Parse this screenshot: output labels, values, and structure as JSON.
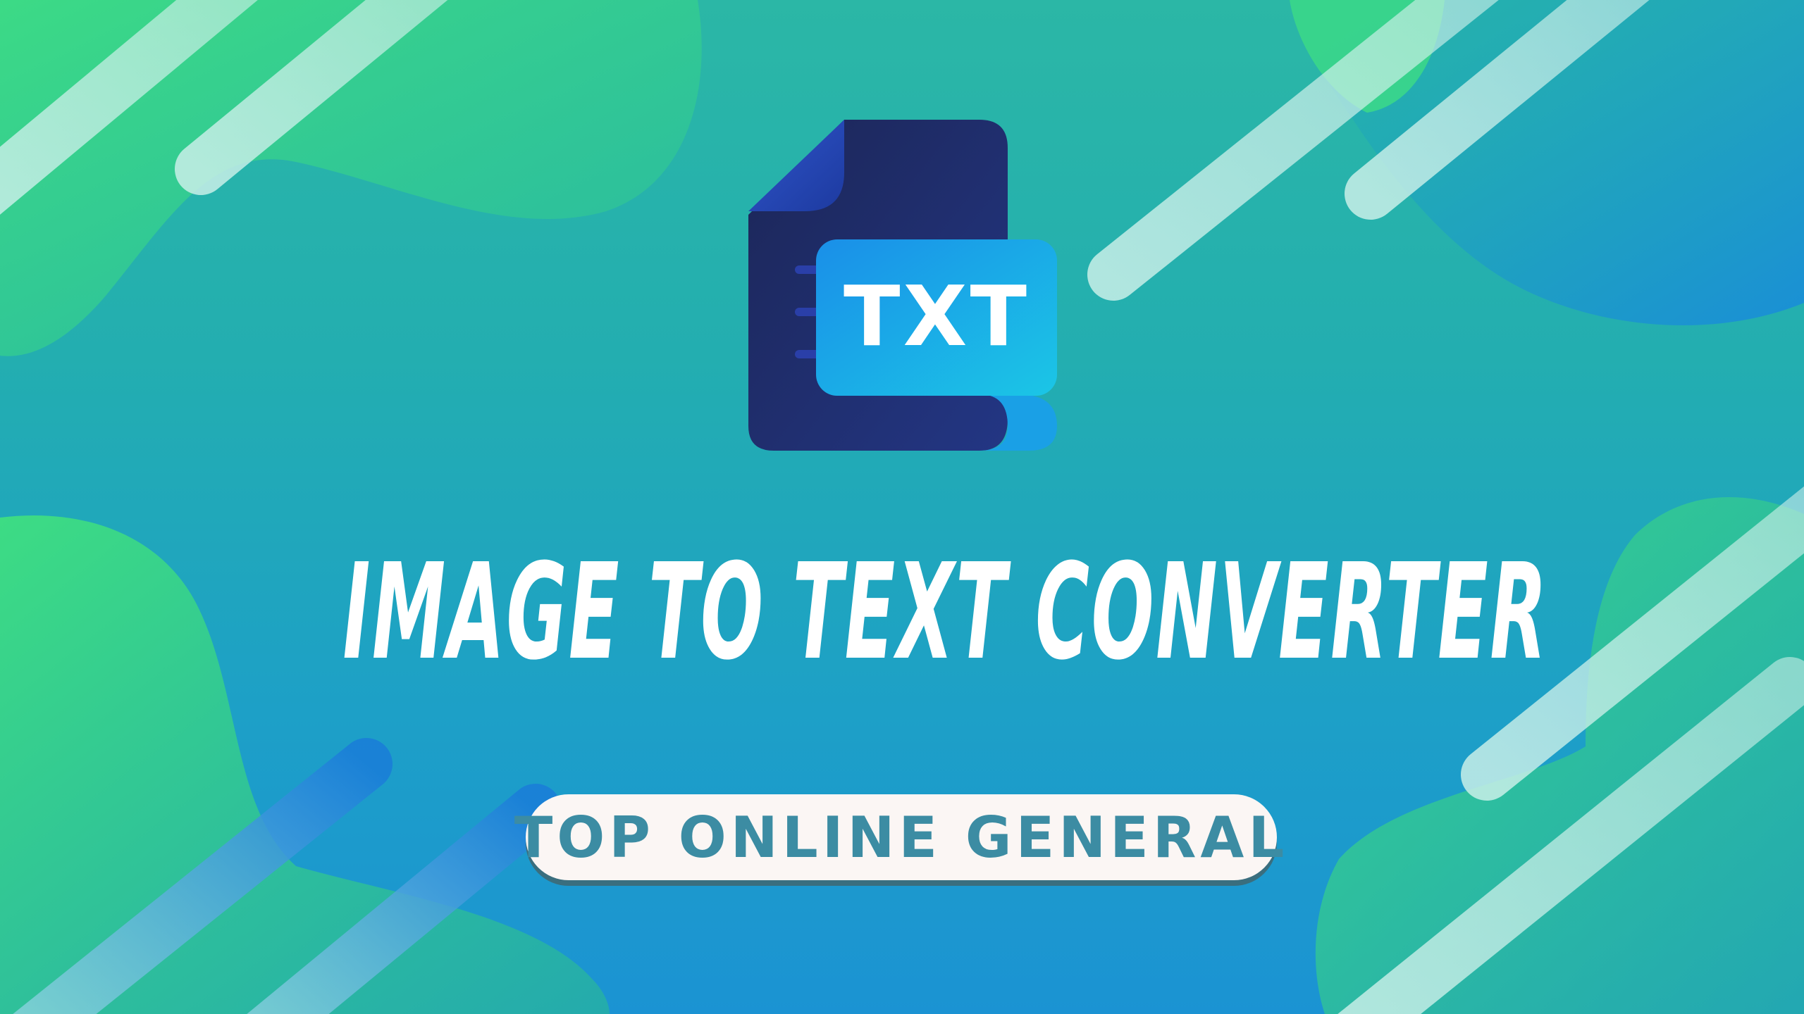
{
  "banner": {
    "icon": {
      "name": "txt-file-icon",
      "label": "TXT"
    },
    "title": "IMAGE TO TEXT CONVERTER",
    "badge": "TOP ONLINE GENERAL"
  },
  "colors": {
    "background_top": "#2bb7a6",
    "background_bottom": "#1b93d3",
    "blob_green": "#3ddc84",
    "file_dark": "#1f2a63",
    "file_blue": "#1aa3ea",
    "title_text": "#ffffff",
    "badge_bg": "#fbf6f4",
    "badge_text": "#3c8ca3"
  }
}
